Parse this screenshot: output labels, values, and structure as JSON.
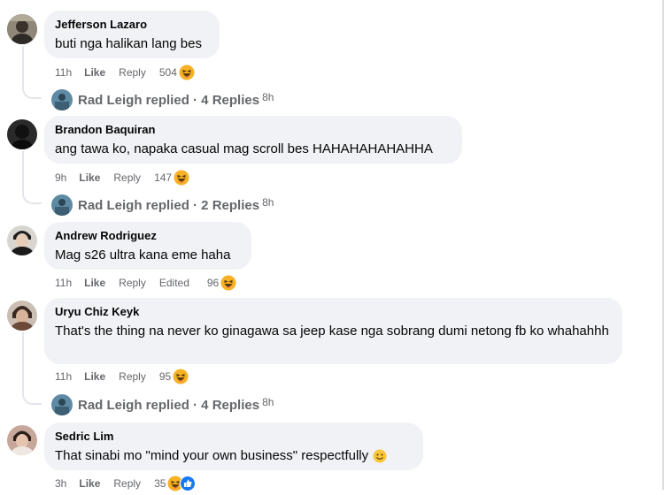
{
  "comments": [
    {
      "author": "Jefferson Lazaro",
      "text": "buti nga halikan lang bes",
      "time": "11h",
      "like": "Like",
      "reply": "Reply",
      "reactions": "504",
      "reaction_icon": "haha-emoji-icon",
      "replies": {
        "text": "Rad Leigh replied · 4 Replies",
        "ago": "8h"
      }
    },
    {
      "author": "Brandon Baquiran",
      "text": "ang tawa ko, napaka casual mag scroll bes HAHAHAHAHAHHA",
      "time": "9h",
      "like": "Like",
      "reply": "Reply",
      "reactions": "147",
      "reaction_icon": "haha-emoji-icon",
      "replies": {
        "text": "Rad Leigh replied · 2 Replies",
        "ago": "8h"
      }
    },
    {
      "author": "Andrew Rodriguez",
      "text": "Mag s26 ultra kana eme haha",
      "time": "11h",
      "like": "Like",
      "reply": "Reply",
      "edited": "Edited",
      "reactions": "96",
      "reaction_icon": "haha-emoji-icon"
    },
    {
      "author": "Uryu Chiz Keyk",
      "text": "That's the thing na never ko ginagawa sa jeep kase nga sobrang dumi netong fb ko whahahhh",
      "time": "11h",
      "like": "Like",
      "reply": "Reply",
      "reactions": "95",
      "reaction_icon": "haha-emoji-icon",
      "replies": {
        "text": "Rad Leigh replied · 4 Replies",
        "ago": "8h"
      }
    },
    {
      "author": "Sedric Lim",
      "text": "That sinabi mo \"mind your own business\" respectfully",
      "text_emoji": "smile-emoji-icon",
      "time": "3h",
      "like": "Like",
      "reply": "Reply",
      "reactions": "35",
      "reaction_icon": "haha-like-emoji-icon"
    }
  ],
  "colors": {
    "bubble": "#f0f2f5",
    "meta_text": "#65676b",
    "haha_yellow": "#f7b125",
    "like_blue": "#1877f2"
  }
}
